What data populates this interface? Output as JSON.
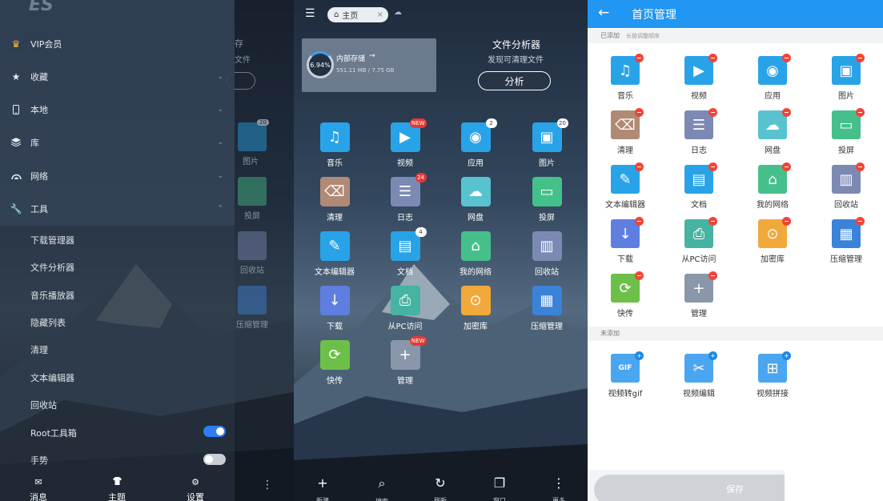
{
  "drawer": {
    "menu": [
      {
        "label": "VIP会员",
        "icon": "crown-icon"
      },
      {
        "label": "收藏",
        "icon": "star-icon"
      },
      {
        "label": "本地",
        "icon": "phone-icon"
      },
      {
        "label": "库",
        "icon": "layers-icon"
      },
      {
        "label": "网络",
        "icon": "network-icon"
      },
      {
        "label": "工具",
        "icon": "wrench-icon"
      }
    ],
    "tools": [
      "下载管理器",
      "文件分析器",
      "音乐播放器",
      "隐藏列表",
      "清理",
      "文本编辑器",
      "回收站",
      "Root工具箱",
      "手势"
    ],
    "toggles": {
      "root_on": true,
      "gesture_on": false
    },
    "bottom": [
      {
        "label": "消息",
        "icon": "mail-icon"
      },
      {
        "label": "主题",
        "icon": "shirt-icon"
      },
      {
        "label": "设置",
        "icon": "gear-icon"
      }
    ],
    "behind": {
      "storage_fragment": "存",
      "file_fragment": "文件",
      "pictures": "图片",
      "pictures_badge": "20",
      "cast": "投屏",
      "recycle": "回收站",
      "compress": "压缩管理"
    }
  },
  "home": {
    "tab": "主页",
    "storage": {
      "percent": "6.94%",
      "label": "内部存储",
      "usage": "551.11 MB / 7.75 GB",
      "fraction": 0.0694
    },
    "analysis": {
      "title": "文件分析器",
      "subtitle": "发现可清理文件",
      "button": "分析"
    },
    "apps": [
      {
        "label": "音乐",
        "icon": "music-icon",
        "color": "#29a3e8",
        "badge": ""
      },
      {
        "label": "视频",
        "icon": "video-icon",
        "color": "#29a3e8",
        "badge": "NEW"
      },
      {
        "label": "应用",
        "icon": "android-icon",
        "color": "#29a3e8",
        "badge": "2"
      },
      {
        "label": "图片",
        "icon": "image-icon",
        "color": "#29a3e8",
        "badge": "20"
      },
      {
        "label": "清理",
        "icon": "broom-icon",
        "color": "#b08a74",
        "badge": ""
      },
      {
        "label": "日志",
        "icon": "log-icon",
        "color": "#7c8ab3",
        "badge": "24"
      },
      {
        "label": "网盘",
        "icon": "cloud-icon",
        "color": "#58c3cf",
        "badge": ""
      },
      {
        "label": "投屏",
        "icon": "cast-icon",
        "color": "#46c08a",
        "badge": ""
      },
      {
        "label": "文本编辑器",
        "icon": "edit-icon",
        "color": "#29a3e8",
        "badge": ""
      },
      {
        "label": "文档",
        "icon": "doc-icon",
        "color": "#29a3e8",
        "badge": "4"
      },
      {
        "label": "我的网络",
        "icon": "router-icon",
        "color": "#46c08a",
        "badge": ""
      },
      {
        "label": "回收站",
        "icon": "trash-icon",
        "color": "#7c8ab3",
        "badge": ""
      },
      {
        "label": "下载",
        "icon": "download-icon",
        "color": "#5e7fe0",
        "badge": ""
      },
      {
        "label": "从PC访问",
        "icon": "pc-icon",
        "color": "#46b3a3",
        "badge": ""
      },
      {
        "label": "加密库",
        "icon": "safe-icon",
        "color": "#f2a93b",
        "badge": ""
      },
      {
        "label": "压缩管理",
        "icon": "zip-icon",
        "color": "#3b82d9",
        "badge": ""
      },
      {
        "label": "快传",
        "icon": "transfer-icon",
        "color": "#6cc04a",
        "badge": ""
      },
      {
        "label": "管理",
        "icon": "plus-icon",
        "color": "#8a97aa",
        "badge": "NEW"
      }
    ],
    "nav": [
      {
        "label": "新建",
        "icon": "plus-icon"
      },
      {
        "label": "搜索",
        "icon": "search-icon"
      },
      {
        "label": "刷新",
        "icon": "refresh-icon"
      },
      {
        "label": "窗口",
        "icon": "windows-icon"
      },
      {
        "label": "更多",
        "icon": "more-icon"
      }
    ]
  },
  "manage": {
    "title": "首页管理",
    "added_label": "已添加",
    "added_hint": "长按调整顺序",
    "added": [
      {
        "label": "音乐",
        "icon": "music-icon",
        "color": "#29a3e8"
      },
      {
        "label": "视频",
        "icon": "video-icon",
        "color": "#29a3e8"
      },
      {
        "label": "应用",
        "icon": "android-icon",
        "color": "#29a3e8"
      },
      {
        "label": "图片",
        "icon": "image-icon",
        "color": "#29a3e8"
      },
      {
        "label": "清理",
        "icon": "broom-icon",
        "color": "#b08a74"
      },
      {
        "label": "日志",
        "icon": "log-icon",
        "color": "#7c8ab3"
      },
      {
        "label": "网盘",
        "icon": "cloud-icon",
        "color": "#58c3cf"
      },
      {
        "label": "投屏",
        "icon": "cast-icon",
        "color": "#46c08a"
      },
      {
        "label": "文本编辑器",
        "icon": "edit-icon",
        "color": "#29a3e8"
      },
      {
        "label": "文档",
        "icon": "doc-icon",
        "color": "#29a3e8"
      },
      {
        "label": "我的网络",
        "icon": "router-icon",
        "color": "#46c08a"
      },
      {
        "label": "回收站",
        "icon": "trash-icon",
        "color": "#7c8ab3"
      },
      {
        "label": "下载",
        "icon": "download-icon",
        "color": "#5e7fe0"
      },
      {
        "label": "从PC访问",
        "icon": "pc-icon",
        "color": "#46b3a3"
      },
      {
        "label": "加密库",
        "icon": "safe-icon",
        "color": "#f2a93b"
      },
      {
        "label": "压缩管理",
        "icon": "zip-icon",
        "color": "#3b82d9"
      },
      {
        "label": "快传",
        "icon": "transfer-icon",
        "color": "#6cc04a"
      },
      {
        "label": "管理",
        "icon": "plus-icon",
        "color": "#8a97aa"
      }
    ],
    "not_added_label": "未添加",
    "not_added": [
      {
        "label": "视频转gif",
        "icon": "gif-icon",
        "color": "#4aa6f0"
      },
      {
        "label": "视频编辑",
        "icon": "video-edit-icon",
        "color": "#4aa6f0"
      },
      {
        "label": "视频拼接",
        "icon": "video-merge-icon",
        "color": "#4aa6f0"
      }
    ],
    "save": "保存"
  }
}
